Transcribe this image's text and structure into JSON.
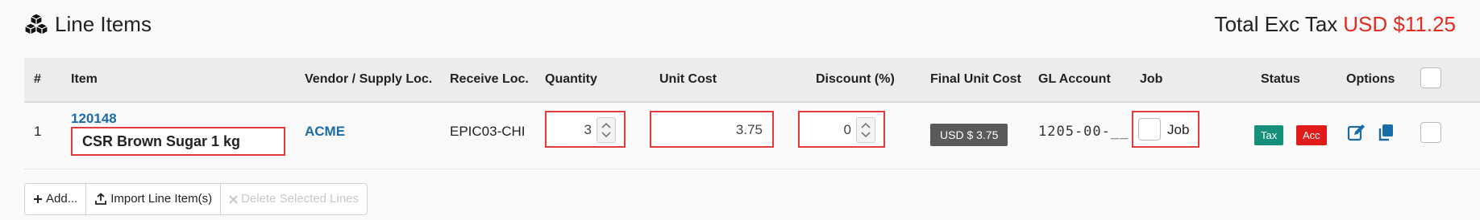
{
  "header": {
    "title": "Line Items",
    "total_label": "Total Exc Tax",
    "total_amount": "USD $11.25",
    "icon": "cubes-icon"
  },
  "columns": {
    "num": "#",
    "item": "Item",
    "vendor": "Vendor / Supply Loc.",
    "receive": "Receive Loc.",
    "quantity": "Quantity",
    "unit_cost": "Unit Cost",
    "discount": "Discount (%)",
    "final_unit_cost": "Final Unit Cost",
    "gl_account": "GL Account",
    "job": "Job",
    "status": "Status",
    "options": "Options"
  },
  "rows": [
    {
      "num": "1",
      "item_code": "120148",
      "item_name": "CSR Brown Sugar 1 kg",
      "vendor": "ACME",
      "receive_loc": "EPIC03-CHI",
      "quantity": "3",
      "unit_cost": "3.75",
      "discount": "0",
      "final_unit_cost": "USD $ 3.75",
      "gl_account": "1205-00-__",
      "job_label": "Job",
      "status_tax": "Tax",
      "status_acc": "Acc"
    }
  ],
  "actions": {
    "add": "Add...",
    "import": "Import Line Item(s)",
    "delete": "Delete Selected Lines"
  },
  "colors": {
    "accent_red": "#e52b20",
    "link_blue": "#1a6ba8",
    "tax_green": "#14907a",
    "acc_red": "#e11a1a",
    "highlight_border": "#e23b3b"
  }
}
